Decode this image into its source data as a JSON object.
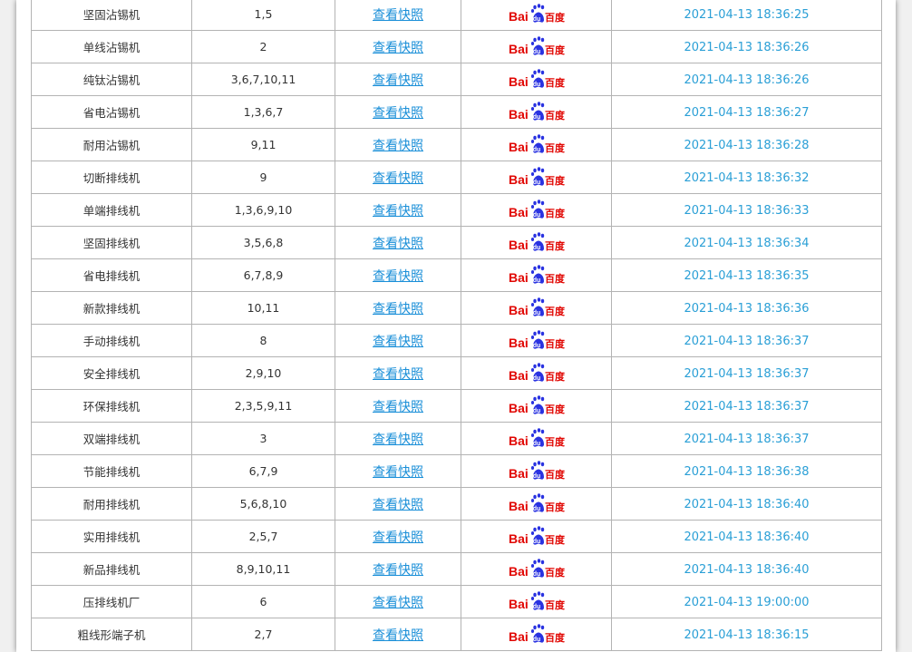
{
  "table": {
    "rows": [
      {
        "keyword": "坚固沾锡机",
        "ranks": "1,5",
        "snapshot": "查看快照",
        "engine": "Baidu 百度",
        "time": "2021-04-13 18:36:25"
      },
      {
        "keyword": "单线沾锡机",
        "ranks": "2",
        "snapshot": "查看快照",
        "engine": "Baidu 百度",
        "time": "2021-04-13 18:36:26"
      },
      {
        "keyword": "纯钛沾锡机",
        "ranks": "3,6,7,10,11",
        "snapshot": "查看快照",
        "engine": "Baidu 百度",
        "time": "2021-04-13 18:36:26"
      },
      {
        "keyword": "省电沾锡机",
        "ranks": "1,3,6,7",
        "snapshot": "查看快照",
        "engine": "Baidu 百度",
        "time": "2021-04-13 18:36:27"
      },
      {
        "keyword": "耐用沾锡机",
        "ranks": "9,11",
        "snapshot": "查看快照",
        "engine": "Baidu 百度",
        "time": "2021-04-13 18:36:28"
      },
      {
        "keyword": "切断排线机",
        "ranks": "9",
        "snapshot": "查看快照",
        "engine": "Baidu 百度",
        "time": "2021-04-13 18:36:32"
      },
      {
        "keyword": "单端排线机",
        "ranks": "1,3,6,9,10",
        "snapshot": "查看快照",
        "engine": "Baidu 百度",
        "time": "2021-04-13 18:36:33"
      },
      {
        "keyword": "坚固排线机",
        "ranks": "3,5,6,8",
        "snapshot": "查看快照",
        "engine": "Baidu 百度",
        "time": "2021-04-13 18:36:34"
      },
      {
        "keyword": "省电排线机",
        "ranks": "6,7,8,9",
        "snapshot": "查看快照",
        "engine": "Baidu 百度",
        "time": "2021-04-13 18:36:35"
      },
      {
        "keyword": "新款排线机",
        "ranks": "10,11",
        "snapshot": "查看快照",
        "engine": "Baidu 百度",
        "time": "2021-04-13 18:36:36"
      },
      {
        "keyword": "手动排线机",
        "ranks": "8",
        "snapshot": "查看快照",
        "engine": "Baidu 百度",
        "time": "2021-04-13 18:36:37"
      },
      {
        "keyword": "安全排线机",
        "ranks": "2,9,10",
        "snapshot": "查看快照",
        "engine": "Baidu 百度",
        "time": "2021-04-13 18:36:37"
      },
      {
        "keyword": "环保排线机",
        "ranks": "2,3,5,9,11",
        "snapshot": "查看快照",
        "engine": "Baidu 百度",
        "time": "2021-04-13 18:36:37"
      },
      {
        "keyword": "双端排线机",
        "ranks": "3",
        "snapshot": "查看快照",
        "engine": "Baidu 百度",
        "time": "2021-04-13 18:36:37"
      },
      {
        "keyword": "节能排线机",
        "ranks": "6,7,9",
        "snapshot": "查看快照",
        "engine": "Baidu 百度",
        "time": "2021-04-13 18:36:38"
      },
      {
        "keyword": "耐用排线机",
        "ranks": "5,6,8,10",
        "snapshot": "查看快照",
        "engine": "Baidu 百度",
        "time": "2021-04-13 18:36:40"
      },
      {
        "keyword": "实用排线机",
        "ranks": "2,5,7",
        "snapshot": "查看快照",
        "engine": "Baidu 百度",
        "time": "2021-04-13 18:36:40"
      },
      {
        "keyword": "新品排线机",
        "ranks": "8,9,10,11",
        "snapshot": "查看快照",
        "engine": "Baidu 百度",
        "time": "2021-04-13 18:36:40"
      },
      {
        "keyword": "压排线机厂",
        "ranks": "6",
        "snapshot": "查看快照",
        "engine": "Baidu 百度",
        "time": "2021-04-13 19:00:00"
      },
      {
        "keyword": "粗线形端子机",
        "ranks": "2,7",
        "snapshot": "查看快照",
        "engine": "Baidu 百度",
        "time": "2021-04-13 18:36:15"
      }
    ]
  },
  "colors": {
    "link": "#1a8fd8",
    "time": "#2a9fd6",
    "baidu_red": "#e10602",
    "baidu_blue": "#2932e1",
    "border": "#b3b3b3"
  },
  "icons": {
    "engine_logo": "baidu-logo-icon"
  }
}
